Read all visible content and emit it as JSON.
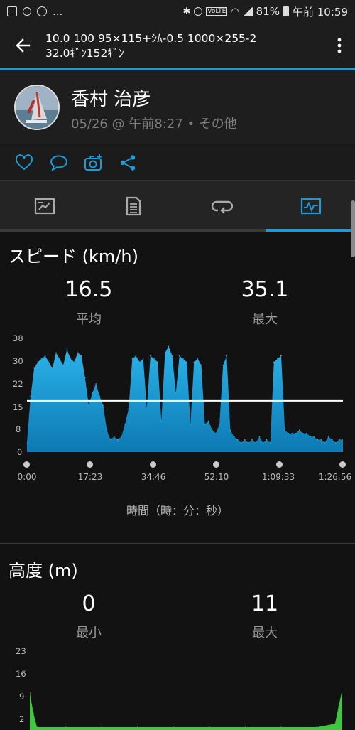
{
  "status_bar": {
    "left_icons": [
      "image-icon",
      "hand-icon",
      "messenger-icon"
    ],
    "overflow": "...",
    "right_icons": [
      "bluetooth-icon",
      "alarm-icon",
      "volte-icon",
      "wifi-icon",
      "signal-icon"
    ],
    "battery": "81%",
    "time": "午前 10:59"
  },
  "app_bar": {
    "title_line1": "10.0 100 95×115+ｼﾑ-0.5 1000×255-2",
    "title_line2": "32.0ｷﾞﾝ152ｷﾞﾝ"
  },
  "activity": {
    "user_name": "香村 治彦",
    "meta": "05/26 @ 午前8:27 • その他"
  },
  "actions": [
    "like-icon",
    "comment-icon",
    "add-photo-icon",
    "share-icon"
  ],
  "tabs": [
    {
      "icon": "summary-tab-icon",
      "active": false
    },
    {
      "icon": "details-tab-icon",
      "active": false
    },
    {
      "icon": "laps-tab-icon",
      "active": false
    },
    {
      "icon": "charts-tab-icon",
      "active": true
    }
  ],
  "colors": {
    "accent": "#1e9bd7",
    "speed_fill": "#1e9bd7",
    "elevation_fill": "#3fc73f",
    "average_line": "#ffffff"
  },
  "speed": {
    "title": "スピード (km/h)",
    "avg_value": "16.5",
    "avg_label": "平均",
    "max_value": "35.1",
    "max_label": "最大",
    "y_ticks": [
      "38",
      "30",
      "22",
      "15",
      "8",
      "0"
    ],
    "x_ticks": [
      "0:00",
      "17:23",
      "34:46",
      "52:10",
      "1:09:33",
      "1:26:56"
    ],
    "x_axis_title": "時間（時：分：秒）"
  },
  "elevation": {
    "title": "高度 (m)",
    "min_value": "0",
    "min_label": "最小",
    "max_value": "11",
    "max_label": "最大",
    "y_ticks": [
      "23",
      "16",
      "9",
      "2"
    ]
  },
  "chart_data": [
    {
      "type": "area",
      "title": "スピード (km/h)",
      "xlabel": "時間（時：分：秒）",
      "ylabel": "",
      "ylim": [
        0,
        38
      ],
      "x_unit": "minutes",
      "x": [
        0,
        1,
        2,
        3,
        4,
        5,
        6,
        7,
        8,
        9,
        10,
        11,
        12,
        13,
        14,
        15,
        16,
        17,
        18,
        19,
        20,
        21,
        22,
        23,
        24,
        25,
        26,
        27,
        28,
        29,
        30,
        31,
        32,
        33,
        34,
        35,
        36,
        37,
        38,
        39,
        40,
        41,
        42,
        43,
        44,
        45,
        46,
        47,
        48,
        49,
        50,
        51,
        52,
        53,
        54,
        55,
        56,
        57,
        58,
        59,
        60,
        61,
        62,
        63,
        64,
        65,
        66,
        67,
        68,
        69,
        70,
        71,
        72,
        73,
        74,
        75,
        76,
        77,
        78,
        79,
        80,
        81,
        82,
        83,
        84,
        85,
        86,
        87
      ],
      "y": [
        3,
        18,
        27,
        29,
        30,
        31,
        29,
        27,
        32,
        30,
        28,
        33,
        30,
        29,
        32,
        31,
        24,
        15,
        19,
        22,
        18,
        15,
        7,
        4,
        5,
        4,
        5,
        9,
        14,
        30,
        31,
        29,
        30,
        14,
        31,
        30,
        29,
        10,
        32,
        34,
        31,
        19,
        31,
        30,
        29,
        9,
        29,
        30,
        28,
        9,
        10,
        7,
        6,
        9,
        28,
        31,
        7,
        5,
        4,
        3,
        4,
        3,
        4,
        3,
        5,
        3,
        4,
        3,
        29,
        30,
        31,
        7,
        6,
        6,
        6,
        7,
        6,
        6,
        5,
        5,
        4,
        4,
        3,
        5,
        4,
        3,
        4,
        4
      ],
      "average_line": 16.5,
      "max": 35.1,
      "grid": false
    },
    {
      "type": "area",
      "title": "高度 (m)",
      "xlabel": "",
      "ylabel": "",
      "x_unit": "minutes",
      "x": [
        0,
        1,
        2,
        10,
        20,
        30,
        40,
        50,
        60,
        70,
        80,
        85,
        86,
        87
      ],
      "y": [
        10,
        4,
        0,
        0,
        0,
        0,
        0,
        0,
        0,
        0,
        0,
        1,
        6,
        11
      ],
      "min": 0,
      "max": 11,
      "grid": false
    }
  ]
}
